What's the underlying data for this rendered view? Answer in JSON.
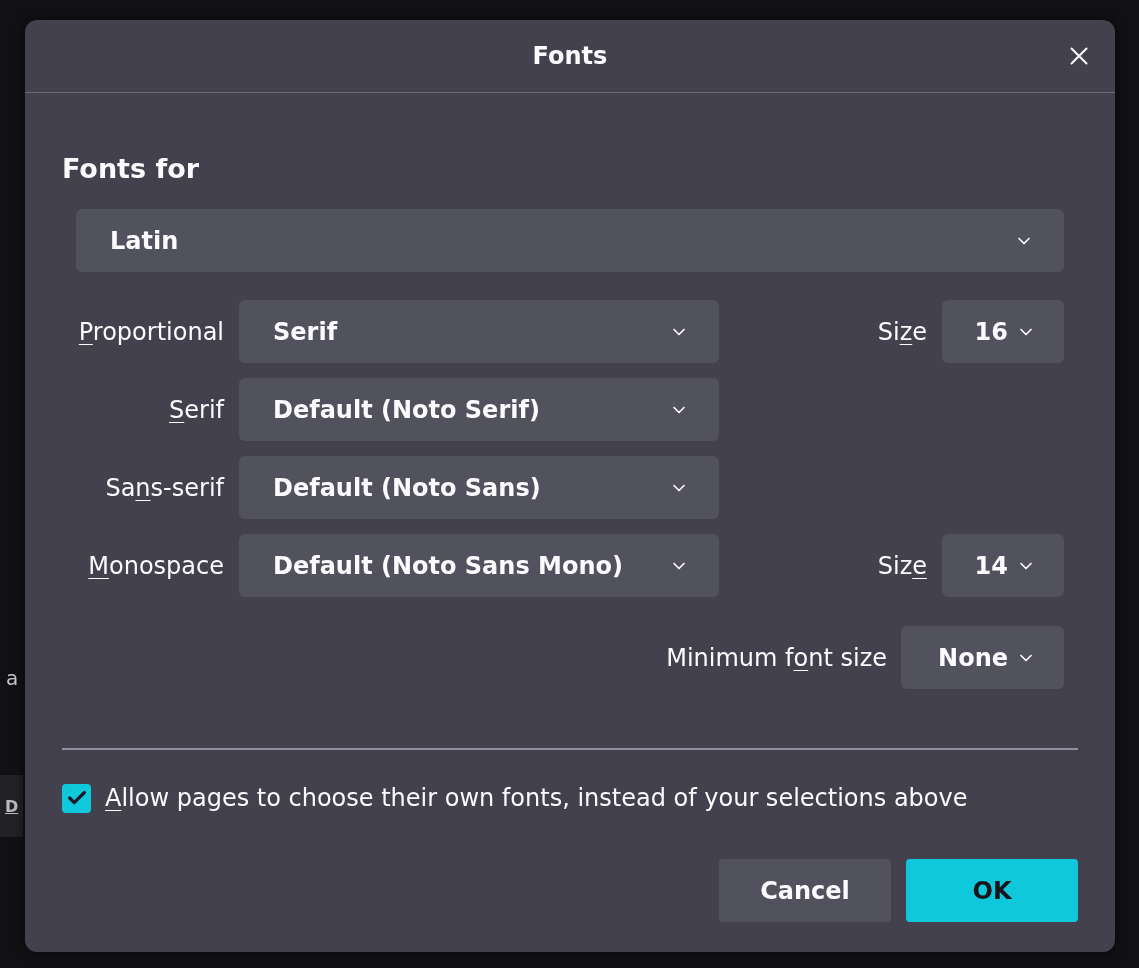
{
  "background": {
    "text_1": "a",
    "text_2": "D"
  },
  "window": {
    "title": "Fonts"
  },
  "fonts_for": {
    "heading": "Fonts for",
    "value": "Latin"
  },
  "rows": [
    {
      "label": {
        "key": "P",
        "post": "roportional"
      },
      "value": "Serif",
      "size": {
        "label": {
          "pre": "Si",
          "key": "z",
          "post": "e"
        },
        "value": "16"
      }
    },
    {
      "label": {
        "key": "S",
        "post": "erif"
      },
      "value": "Default (Noto Serif)"
    },
    {
      "label": {
        "pre": "Sa",
        "key": "n",
        "post": "s-serif"
      },
      "value": "Default (Noto Sans)"
    },
    {
      "label": {
        "key": "M",
        "post": "onospace"
      },
      "value": "Default (Noto Sans Mono)",
      "size": {
        "label": {
          "pre": "Siz",
          "key": "e"
        },
        "value": "14"
      }
    }
  ],
  "minimum": {
    "label": {
      "pre": "Minimum f",
      "key": "o",
      "post": "nt size"
    },
    "value": "None"
  },
  "allow": {
    "label": {
      "key": "A",
      "post": "llow pages to choose their own fonts, instead of your selections above"
    },
    "checked": true
  },
  "buttons": [
    {
      "label": "Cancel",
      "kind": "secondary"
    },
    {
      "label": "OK",
      "kind": "primary"
    }
  ]
}
